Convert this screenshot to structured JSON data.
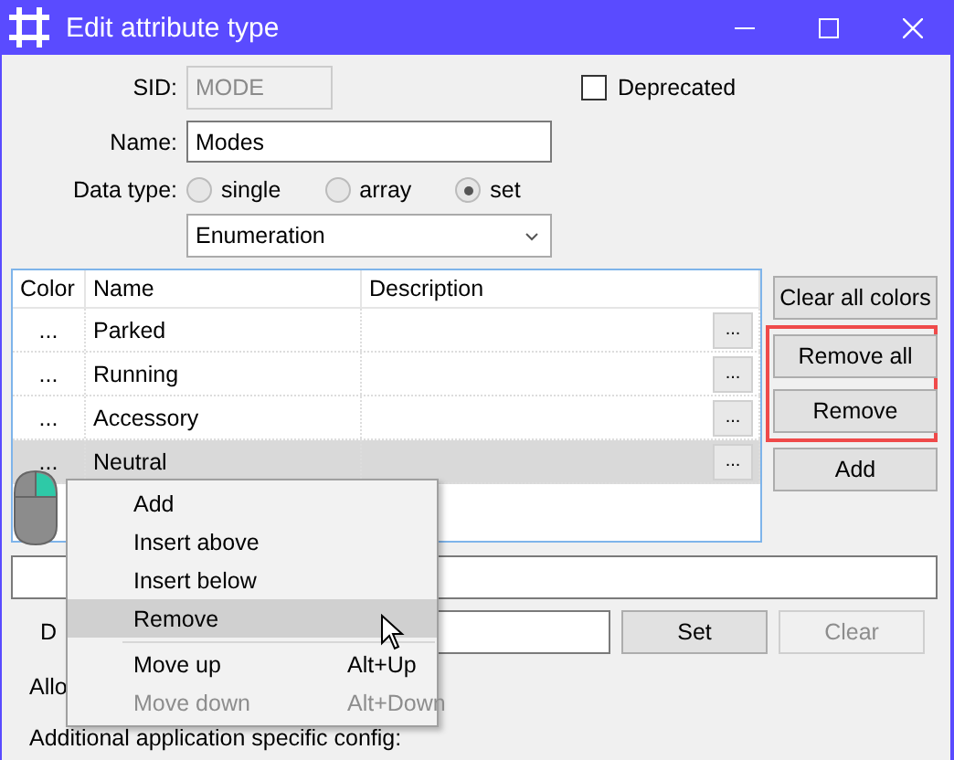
{
  "window": {
    "title": "Edit attribute type"
  },
  "sid": {
    "label": "SID:",
    "value": "MODE",
    "disabled": true
  },
  "deprecated": {
    "label": "Deprecated",
    "checked": false
  },
  "name": {
    "label": "Name:",
    "value": "Modes"
  },
  "data_type": {
    "label": "Data type:",
    "options": [
      {
        "label": "single",
        "selected": false
      },
      {
        "label": "array",
        "selected": false
      },
      {
        "label": "set",
        "selected": true
      }
    ]
  },
  "type_dropdown": {
    "value": "Enumeration"
  },
  "table": {
    "columns": [
      "Color",
      "Name",
      "Description"
    ],
    "rows": [
      {
        "color_button": "...",
        "name": "Parked",
        "edit": "...",
        "selected": false
      },
      {
        "color_button": "...",
        "name": "Running",
        "edit": "...",
        "selected": false
      },
      {
        "color_button": "...",
        "name": "Accessory",
        "edit": "...",
        "selected": false
      },
      {
        "color_button": "...",
        "name": "Neutral",
        "edit": "...",
        "selected": true
      }
    ]
  },
  "side_buttons": [
    {
      "label": "Clear all colors",
      "highlighted": false
    },
    {
      "label": "Remove all",
      "highlighted": true
    },
    {
      "label": "Remove",
      "highlighted": true
    },
    {
      "label": "Add",
      "highlighted": false
    }
  ],
  "default_row": {
    "label": "D",
    "set_button": "Set",
    "clear_button": {
      "label": "Clear",
      "disabled": true
    }
  },
  "allowed_label": "Allo",
  "additional_label": "Additional application specific config:",
  "context_menu": {
    "items": [
      {
        "kind": "item",
        "label": "Add",
        "selected": false,
        "disabled": false
      },
      {
        "kind": "item",
        "label": "Insert above",
        "selected": false,
        "disabled": false
      },
      {
        "kind": "item",
        "label": "Insert below",
        "selected": false,
        "disabled": false
      },
      {
        "kind": "item",
        "label": "Remove",
        "selected": true,
        "disabled": false
      },
      {
        "kind": "separator"
      },
      {
        "kind": "item",
        "label": "Move up",
        "shortcut": "Alt+Up",
        "selected": false,
        "disabled": false
      },
      {
        "kind": "item",
        "label": "Move down",
        "shortcut": "Alt+Down",
        "selected": false,
        "disabled": true
      }
    ]
  }
}
